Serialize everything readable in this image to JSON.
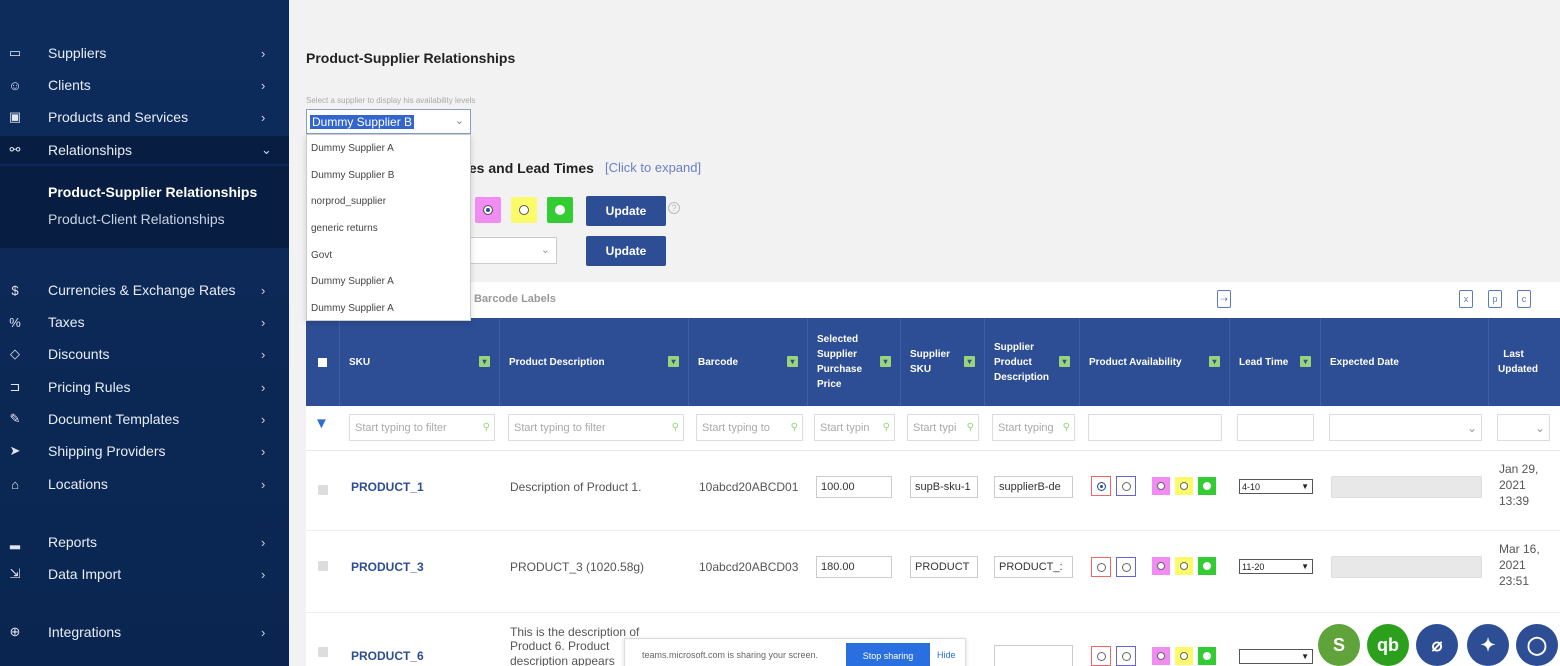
{
  "sidebar": {
    "items": [
      {
        "label": "Suppliers",
        "icon": "truck-icon"
      },
      {
        "label": "Clients",
        "icon": "users-icon"
      },
      {
        "label": "Products and Services",
        "icon": "box-icon"
      },
      {
        "label": "Relationships",
        "icon": "relationship-icon"
      },
      {
        "label": "Currencies & Exchange Rates",
        "icon": "currency-icon"
      },
      {
        "label": "Taxes",
        "icon": "percent-icon"
      },
      {
        "label": "Discounts",
        "icon": "tag-icon"
      },
      {
        "label": "Pricing Rules",
        "icon": "pricing-icon"
      },
      {
        "label": "Document Templates",
        "icon": "pen-icon"
      },
      {
        "label": "Shipping Providers",
        "icon": "send-icon"
      },
      {
        "label": "Locations",
        "icon": "warehouse-icon"
      },
      {
        "label": "Reports",
        "icon": "chart-icon"
      },
      {
        "label": "Data Import",
        "icon": "import-icon"
      },
      {
        "label": "Integrations",
        "icon": "globe-icon"
      }
    ],
    "submenu": [
      "Product-Supplier Relationships",
      "Product-Client Relationships"
    ]
  },
  "page": {
    "title": "Product-Supplier Relationships",
    "hint": "Select a supplier to display his availability levels",
    "selected_supplier": "Dummy Supplier B",
    "section_title": "ies and Lead Times",
    "expand_link": "[Click to expand]",
    "update_label": "Update",
    "barcode_labels": "Barcode Labels"
  },
  "dropdown_options": [
    "Dummy Supplier A",
    "Dummy Supplier B",
    "norprod_supplier",
    "generic returns",
    "Govt",
    "Dummy Supplier A",
    "Dummy Supplier A"
  ],
  "table": {
    "columns": [
      "SKU",
      "Product Description",
      "Barcode",
      "Selected Supplier Purchase Price",
      "Supplier SKU",
      "Supplier Product Description",
      "Product Availability",
      "Lead Time",
      "Expected Date",
      "Last Updated"
    ],
    "filter_placeholders": [
      "Start typing to filter",
      "Start typing to filter",
      "Start typing to",
      "Start typin",
      "Start typi",
      "Start typing"
    ],
    "rows": [
      {
        "sku": "PRODUCT_1",
        "description": "Description of Product 1.",
        "barcode": "10abcd20ABCD01",
        "price": "100.00",
        "supplier_sku": "supB-sku-1",
        "supplier_desc": "supplierB-de",
        "lead_time": "4-10",
        "updated": [
          "Jan 29,",
          "2021",
          "13:39"
        ]
      },
      {
        "sku": "PRODUCT_3",
        "description": "PRODUCT_3 (1020.58g)",
        "barcode": "10abcd20ABCD03",
        "price": "180.00",
        "supplier_sku": "PRODUCT",
        "supplier_desc": "PRODUCT_:",
        "lead_time": "11-20",
        "updated": [
          "Mar 16,",
          "2021",
          "23:51"
        ]
      },
      {
        "sku": "PRODUCT_6",
        "description": "This is the description of Product 6. Product description appears",
        "barcode": "",
        "price": "",
        "supplier_sku": "",
        "supplier_desc": "",
        "lead_time": "",
        "updated": [
          "",
          "",
          ""
        ]
      }
    ]
  },
  "share_bar": {
    "message": "teams.microsoft.com is sharing your screen.",
    "stop": "Stop sharing",
    "hide": "Hide"
  },
  "colors": {
    "sidebar": "#0d2c5c",
    "header": "#2d4e94",
    "accent": "#2a6fe0",
    "pink": "#f18df2",
    "yellow": "#fbfb6a",
    "green": "#33cc33"
  }
}
